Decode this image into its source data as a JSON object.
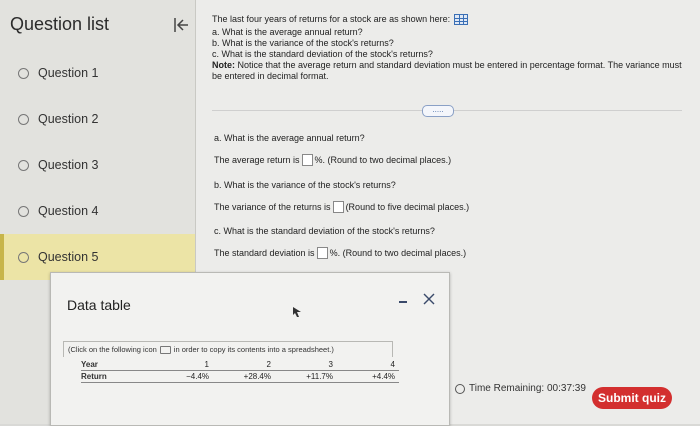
{
  "sidebar": {
    "title": "Question list",
    "items": [
      {
        "label": "Question 1"
      },
      {
        "label": "Question 2"
      },
      {
        "label": "Question 3"
      },
      {
        "label": "Question 4"
      },
      {
        "label": "Question 5"
      }
    ],
    "active_index": 4
  },
  "question": {
    "intro": "The last four years of returns for a stock are as shown here:",
    "parts": [
      "a. What is the average annual return?",
      "b. What is the variance of the stock's returns?",
      "c. What is the standard deviation of the stock's returns?"
    ],
    "note_label": "Note:",
    "note_text": "Notice that the average return and standard deviation must be entered in percentage format. The variance must be entered in decimal format.",
    "more_label": "....."
  },
  "answers": {
    "a_prompt": "a. What is the average annual return?",
    "a_pre": "The average return is",
    "a_post": "%. (Round to two decimal places.)",
    "b_prompt": "b. What is the variance of the stock's returns?",
    "b_pre": "The variance of the returns is",
    "b_post": "(Round to five decimal places.)",
    "c_prompt": "c. What is the standard deviation of the stock's returns?",
    "c_pre": "The standard deviation is",
    "c_post": "%. (Round to two decimal places.)"
  },
  "data_table": {
    "title": "Data table",
    "copy_note_pre": "(Click on the following icon",
    "copy_note_post": "in order to copy its contents into a spreadsheet.)",
    "rows": [
      {
        "label": "Year",
        "values": [
          "1",
          "2",
          "3",
          "4"
        ]
      },
      {
        "label": "Return",
        "values": [
          "−4.4%",
          "+28.4%",
          "+11.7%",
          "+4.4%"
        ]
      }
    ]
  },
  "footer": {
    "timer": "Time Remaining: 00:37:39",
    "submit_label": "Submit quiz"
  },
  "colors": {
    "submit": "#d32f2f",
    "active_question": "#ece4a6"
  }
}
